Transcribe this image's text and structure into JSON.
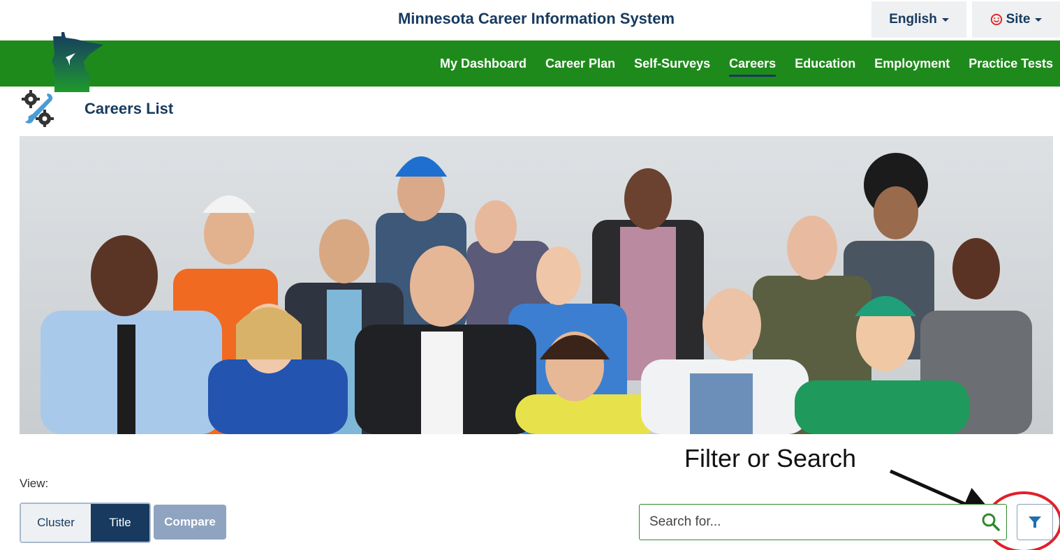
{
  "header": {
    "site_title": "Minnesota Career Information System",
    "language_label": "English",
    "site_label": "Site"
  },
  "nav": {
    "items": [
      {
        "label": "My Dashboard",
        "active": false
      },
      {
        "label": "Career Plan",
        "active": false
      },
      {
        "label": "Self-Surveys",
        "active": false
      },
      {
        "label": "Careers",
        "active": true
      },
      {
        "label": "Education",
        "active": false
      },
      {
        "label": "Employment",
        "active": false
      },
      {
        "label": "Practice Tests",
        "active": false
      }
    ]
  },
  "page": {
    "title": "Careers List",
    "icon": "gears-wrench-icon"
  },
  "annotation": {
    "text": "Filter or Search"
  },
  "view": {
    "label": "View:",
    "options": [
      "Cluster",
      "Title"
    ],
    "selected": "Title",
    "compare_label": "Compare"
  },
  "search": {
    "value": "",
    "placeholder": "Search for..."
  },
  "colors": {
    "nav_green": "#1f8a1c",
    "brand_navy": "#173a5e",
    "compare_disabled": "#8ea4c0",
    "annotation_red": "#e0202a"
  }
}
